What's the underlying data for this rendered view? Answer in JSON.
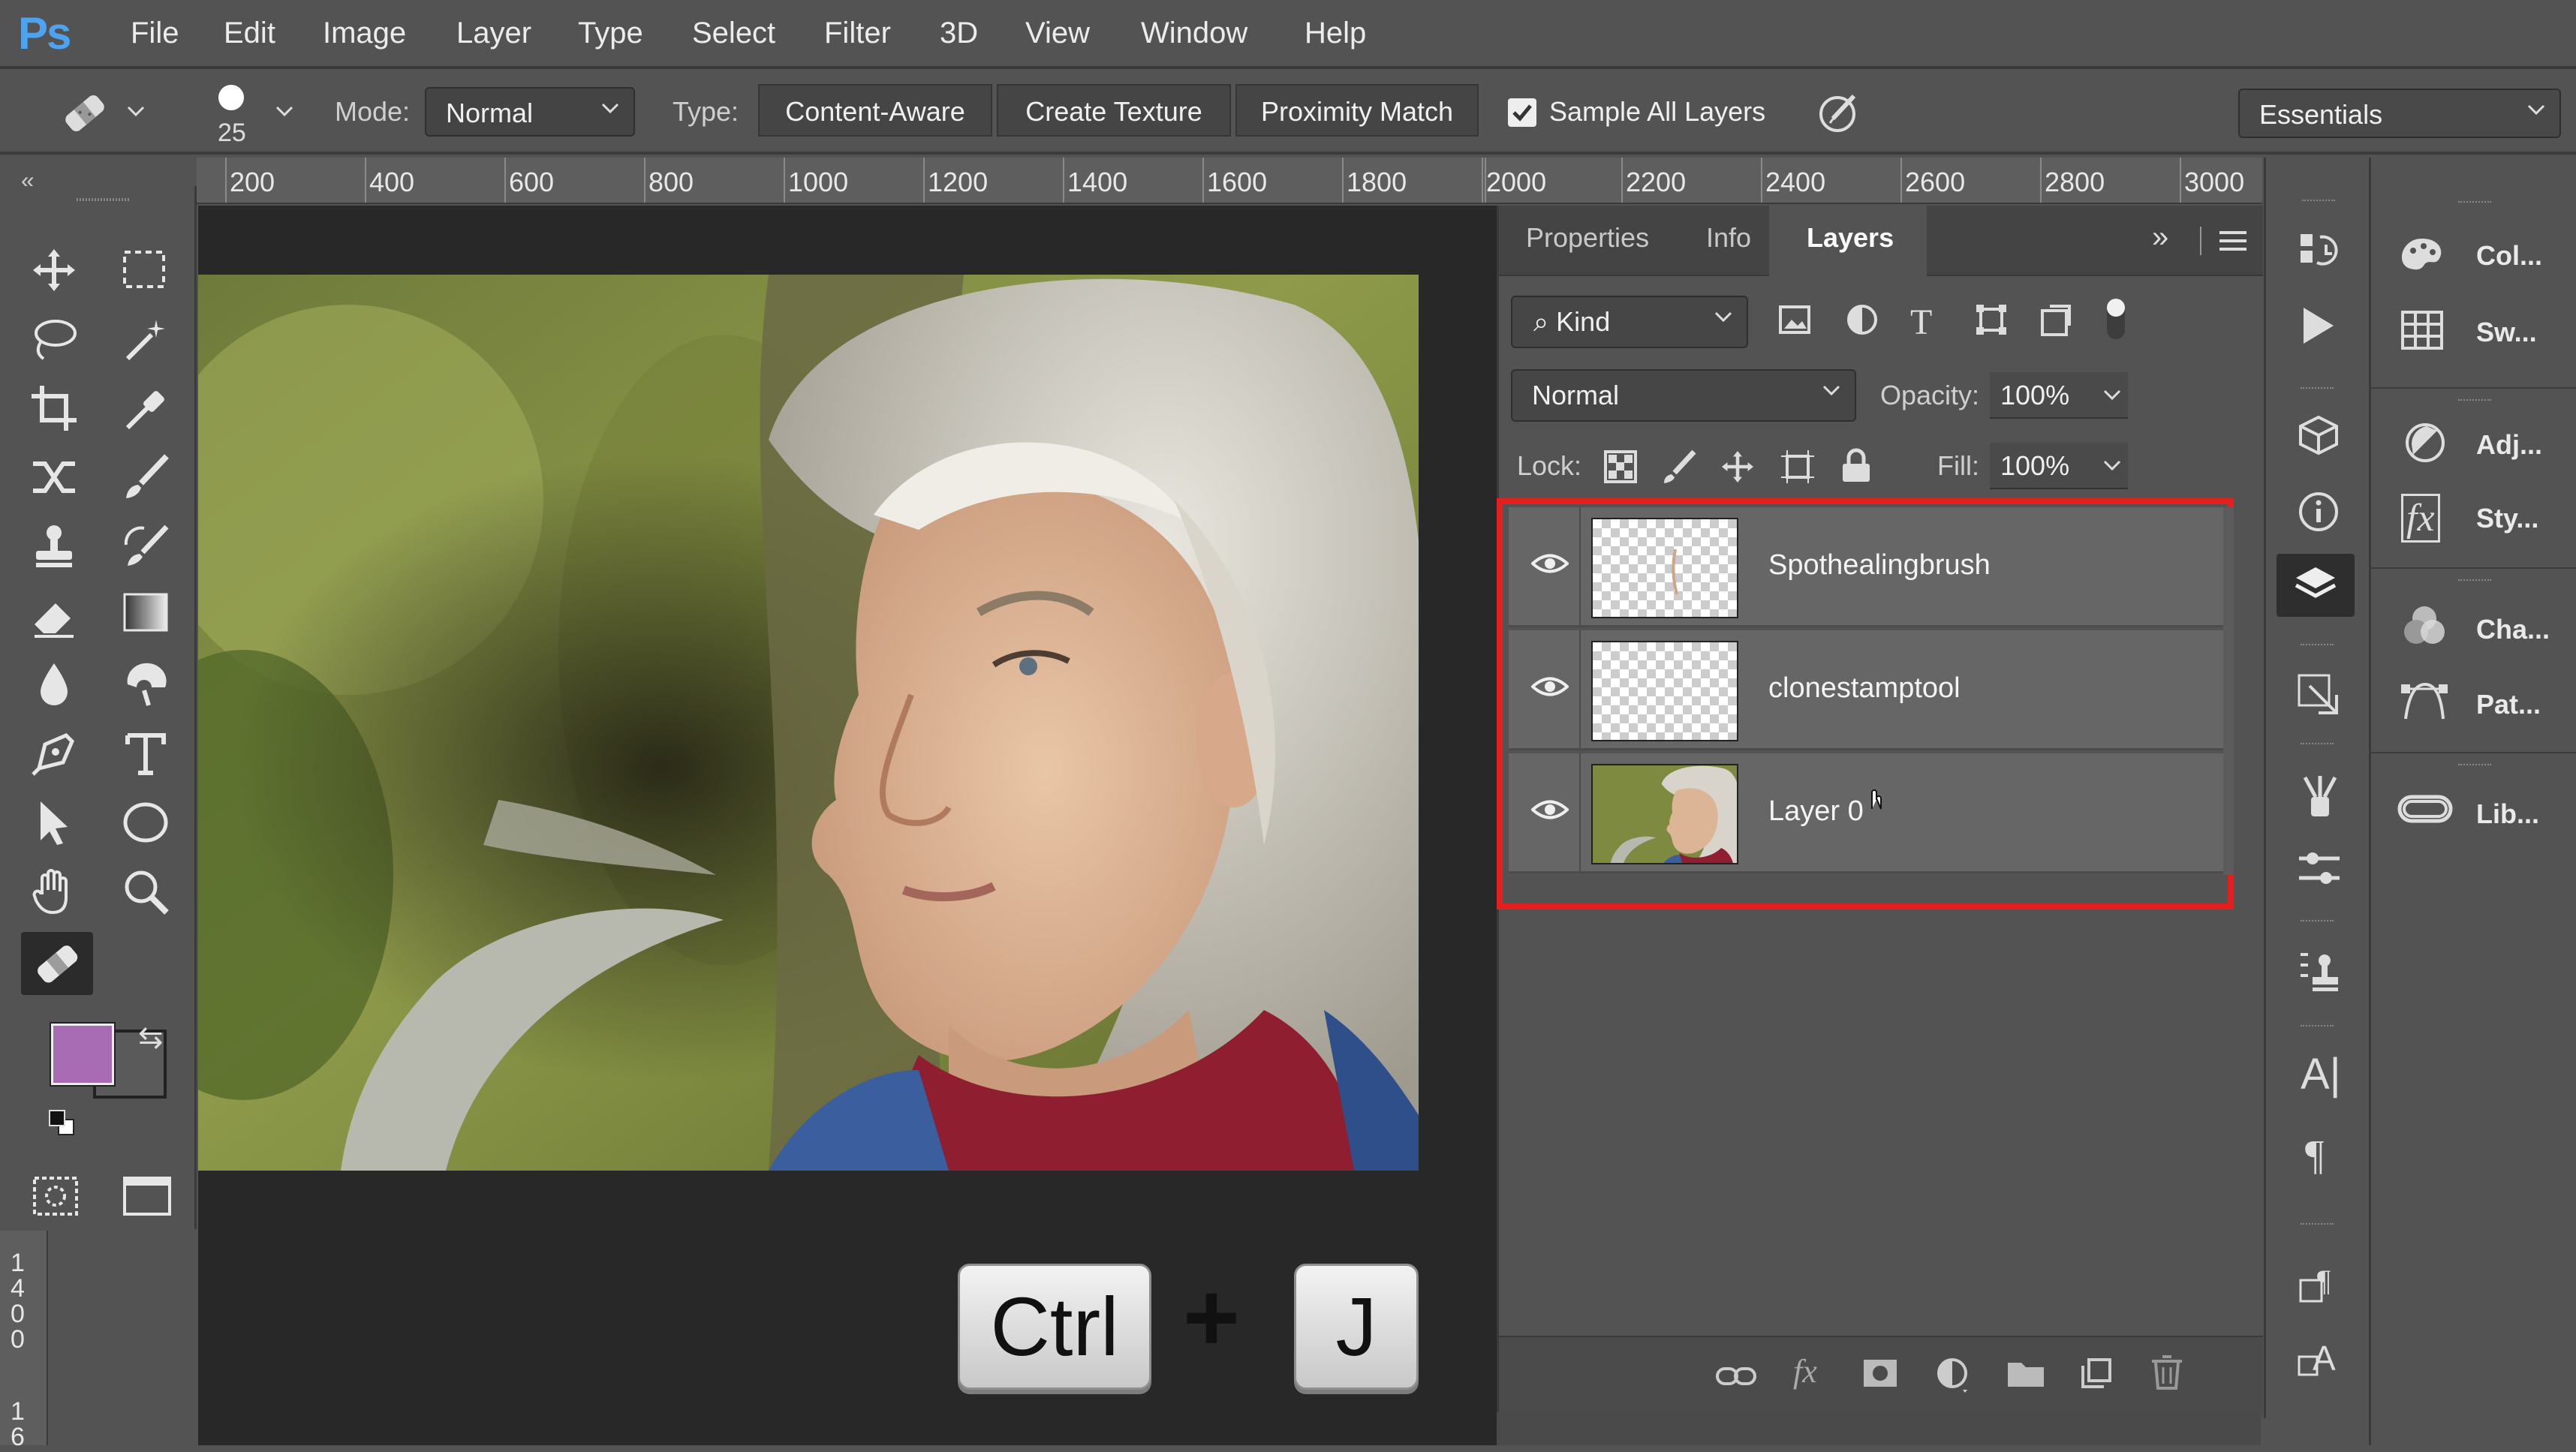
{
  "app": {
    "logo": "Ps"
  },
  "menu": [
    "File",
    "Edit",
    "Image",
    "Layer",
    "Type",
    "Select",
    "Filter",
    "3D",
    "View",
    "Window",
    "Help"
  ],
  "options": {
    "brush_size": "25",
    "mode_label": "Mode:",
    "mode_value": "Normal",
    "type_label": "Type:",
    "type_buttons": [
      "Content-Aware",
      "Create Texture",
      "Proximity Match"
    ],
    "sample_all_layers": "Sample All Layers",
    "sample_checked": true,
    "workspace": "Essentials"
  },
  "ruler": {
    "top_ticks": [
      "200",
      "400",
      "600",
      "800",
      "1000",
      "1200",
      "1400",
      "1600",
      "1800",
      "2000",
      "2200",
      "2400",
      "2600",
      "2800",
      "3000"
    ],
    "left_digits_a": [
      "1",
      "4",
      "0",
      "0"
    ],
    "left_digits_b": [
      "1",
      "6"
    ]
  },
  "toolbar": {
    "foreground_color": "#a76cb4",
    "background_color": "#5a5a5a"
  },
  "layers_panel": {
    "tabs": [
      "Properties",
      "Info",
      "Layers"
    ],
    "active_tab": "Layers",
    "filter_kind": "Kind",
    "blend_mode": "Normal",
    "opacity_label": "Opacity:",
    "opacity_value": "100%",
    "lock_label": "Lock:",
    "fill_label": "Fill:",
    "fill_value": "100%",
    "layers": [
      {
        "name": "Spothealingbrush",
        "visible": true
      },
      {
        "name": "clonestamptool",
        "visible": true
      },
      {
        "name": "Layer 0",
        "visible": true
      }
    ],
    "highlight_color": "#e51e1e"
  },
  "right_panels": [
    "Col...",
    "Sw...",
    "Adj...",
    "Sty...",
    "Cha...",
    "Pat...",
    "Lib..."
  ],
  "shortcut": {
    "key1": "Ctrl",
    "plus": "+",
    "key2": "J"
  }
}
